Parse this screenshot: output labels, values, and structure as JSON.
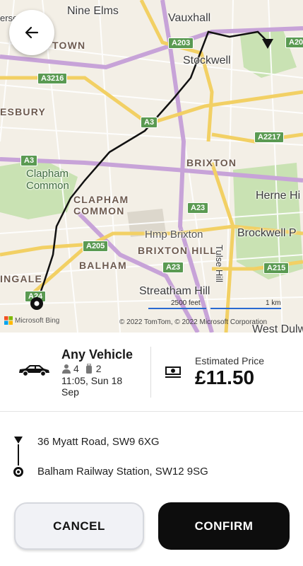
{
  "map": {
    "labels": {
      "nine_elms": "Nine Elms",
      "vauxhall": "Vauxhall",
      "stockwell": "Stockwell",
      "brixton": "BRIXTON",
      "clapham_common_green": "Clapham\nCommon",
      "clapham_common": "CLAPHAM\nCOMMON",
      "herne_hill": "Herne Hi",
      "brockwell": "Brockwell P",
      "hmp_brixton": "Hmp Brixton",
      "brixton_hill": "BRIXTON HILL",
      "balham": "BALHAM",
      "streatham_hill": "Streatham Hill",
      "tulse_hill": "Tulse Hill",
      "west_dulwich": "West Dulwi",
      "ingale": "INGALE",
      "esbury": "ESBURY",
      "town": "TOWN",
      "ersea": "ersea"
    },
    "shields": {
      "a203": "A203",
      "a20": "A20",
      "a3216": "A3216",
      "a3_a": "A3",
      "a3_b": "A3",
      "a2217": "A2217",
      "a23_a": "A23",
      "a23_b": "A23",
      "a205": "A205",
      "a215": "A215",
      "a24": "A24"
    },
    "scale_feet": "2500 feet",
    "scale_km": "1 km",
    "attribution": "Microsoft Bing",
    "copyright": "© 2022 TomTom, © 2022 Microsoft Corporation"
  },
  "vehicle": {
    "name": "Any Vehicle",
    "passengers": "4",
    "luggage": "2",
    "time": "11:05, Sun 18 Sep"
  },
  "price": {
    "label": "Estimated Price",
    "value": "£11.50"
  },
  "route": {
    "destination": "36 Myatt Road, SW9 6XG",
    "origin": "Balham Railway Station, SW12 9SG"
  },
  "actions": {
    "cancel": "CANCEL",
    "confirm": "CONFIRM"
  },
  "icons": [
    "arrow-left-icon",
    "car-icon",
    "person-icon",
    "luggage-icon",
    "money-icon",
    "destination-marker-icon",
    "origin-marker-icon"
  ]
}
